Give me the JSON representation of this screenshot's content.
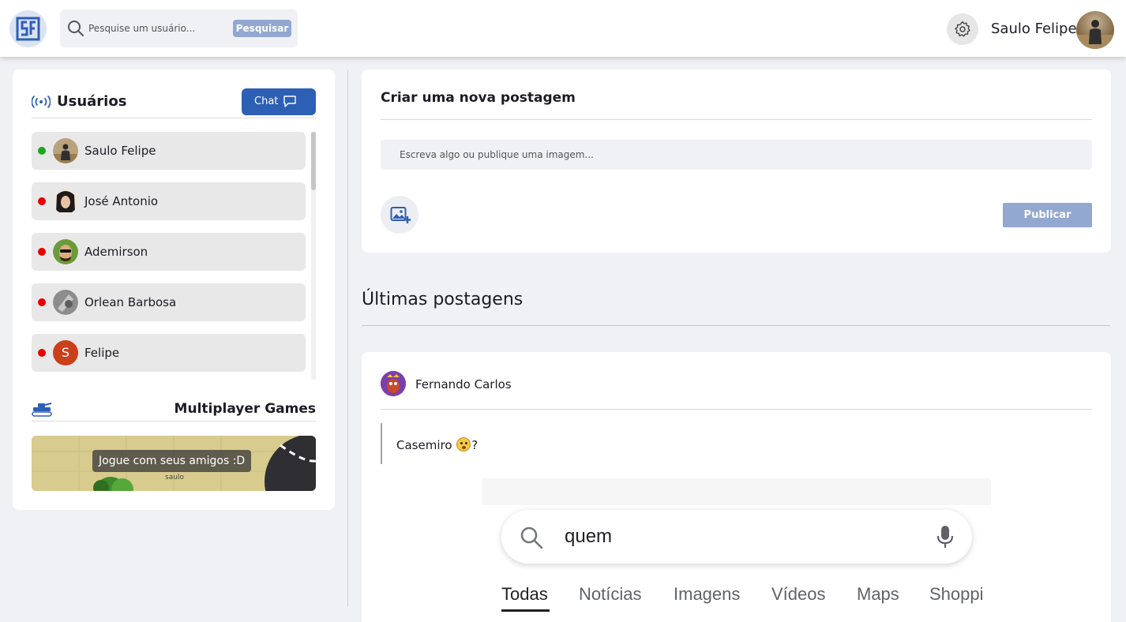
{
  "header": {
    "search_placeholder": "Pesquise um usuário...",
    "search_button": "Pesquisar",
    "username": "Saulo Felipe"
  },
  "users_panel": {
    "title": "Usuários",
    "chat_button": "Chat",
    "users": [
      {
        "name": "Saulo Felipe",
        "status": "online",
        "status_color": "#1fa51f"
      },
      {
        "name": "José Antonio",
        "status": "offline",
        "status_color": "#e60000"
      },
      {
        "name": "Ademirson",
        "status": "offline",
        "status_color": "#e60000"
      },
      {
        "name": "Orlean Barbosa",
        "status": "offline",
        "status_color": "#e60000"
      },
      {
        "name": "Felipe",
        "status": "offline",
        "status_color": "#e60000",
        "avatar_letter": "S"
      }
    ]
  },
  "games": {
    "title": "Multiplayer Games",
    "banner_text": "Jogue com seus amigos :D",
    "banner_small_text": "saulo"
  },
  "create_post": {
    "title": "Criar uma nova postagem",
    "input_placeholder": "Escreva algo ou publique uma imagem...",
    "publish_button": "Publicar"
  },
  "feed": {
    "title": "Últimas postagens",
    "posts": [
      {
        "author": "Fernando Carlos",
        "text_before": "Casemiro ",
        "text_after": "?",
        "image": {
          "query": "quem",
          "tabs": [
            "Todas",
            "Notícias",
            "Imagens",
            "Vídeos",
            "Maps",
            "Shoppi"
          ],
          "active_tab": "Todas"
        }
      }
    ]
  },
  "colors": {
    "primary": "#2d5fb5",
    "button_disabled": "#92a8d1",
    "online": "#1fa51f",
    "offline": "#e60000"
  }
}
